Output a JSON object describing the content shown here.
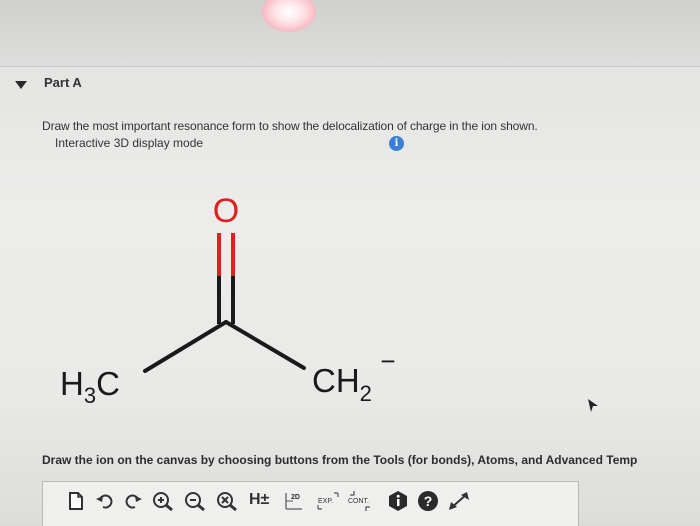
{
  "part": {
    "title": "Part A"
  },
  "question": {
    "prompt": "Draw the most important resonance form to show the delocalization of charge in the ion shown.",
    "display_mode": "Interactive 3D display mode",
    "info_icon": "i"
  },
  "molecule": {
    "oxygen": "O",
    "left_group": {
      "main": "H",
      "sub": "3",
      "tail": "C"
    },
    "right_group": {
      "main": "CH",
      "sub": "2",
      "charge": "−"
    }
  },
  "instruction": "Draw the ion on the canvas by choosing buttons from the Tools (for bonds), Atoms, and Advanced Temp",
  "toolbar": {
    "h_label": "H±",
    "label_2d": "2D",
    "exp_label": "EXP.",
    "cont_label": "CONT.",
    "help": "?"
  },
  "colors": {
    "oxygen": "#e02020",
    "bond": "#1a1a1a",
    "info": "#3a7fd6"
  }
}
